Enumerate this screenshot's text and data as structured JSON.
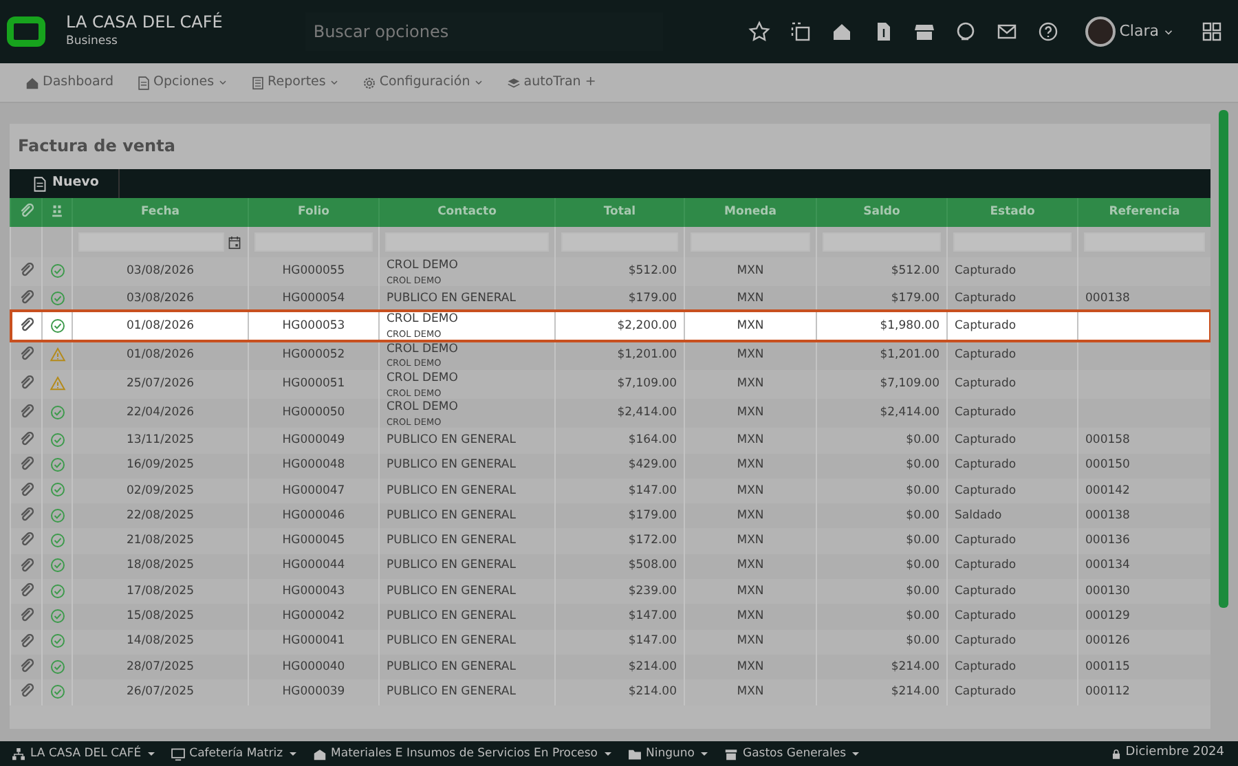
{
  "app": {
    "title": "LA CASA DEL CAFÉ",
    "subtitle": "Business",
    "search": {
      "placeholder": "Buscar opciones"
    },
    "user": "Clara"
  },
  "nav": [
    {
      "label": "Dashboard",
      "dropdown": false
    },
    {
      "label": "Opciones",
      "dropdown": true
    },
    {
      "label": "Reportes",
      "dropdown": true
    },
    {
      "label": "Configuración",
      "dropdown": true
    },
    {
      "label": "autoTran +",
      "dropdown": false
    }
  ],
  "page": {
    "title": "Factura de venta",
    "new_button": "Nuevo"
  },
  "table": {
    "columns": [
      "Fecha",
      "Folio",
      "Contacto",
      "Total",
      "Moneda",
      "Saldo",
      "Estado",
      "Referencia"
    ],
    "rows": [
      {
        "kind": "ok",
        "selected": false,
        "fecha": "03/08/2026",
        "folio": "HG000055",
        "contacto": "CROL DEMO",
        "contacto_sub": "CROL DEMO",
        "total": "$512.00",
        "moneda": "MXN",
        "saldo": "$512.00",
        "estado": "Capturado"
      },
      {
        "kind": "ok",
        "selected": false,
        "fecha": "03/08/2026",
        "folio": "HG000054",
        "contacto": "PUBLICO EN GENERAL",
        "total": "$179.00",
        "moneda": "MXN",
        "saldo": "$179.00",
        "estado": "Capturado",
        "referencia": "000138"
      },
      {
        "kind": "ok",
        "selected": true,
        "fecha": "01/08/2026",
        "folio": "HG000053",
        "contacto": "CROL DEMO",
        "contacto_sub": "CROL DEMO",
        "total": "$2,200.00",
        "moneda": "MXN",
        "saldo": "$1,980.00",
        "estado": "Capturado"
      },
      {
        "kind": "warning",
        "selected": false,
        "fecha": "01/08/2026",
        "folio": "HG000052",
        "contacto": "CROL DEMO",
        "contacto_sub": "CROL DEMO",
        "total": "$1,201.00",
        "moneda": "MXN",
        "saldo": "$1,201.00",
        "estado": "Capturado"
      },
      {
        "kind": "warning",
        "selected": false,
        "fecha": "25/07/2026",
        "folio": "HG000051",
        "contacto": "CROL DEMO",
        "contacto_sub": "CROL DEMO",
        "total": "$7,109.00",
        "moneda": "MXN",
        "saldo": "$7,109.00",
        "estado": "Capturado"
      },
      {
        "kind": "ok",
        "selected": false,
        "fecha": "22/04/2026",
        "folio": "HG000050",
        "contacto": "CROL DEMO",
        "contacto_sub": "CROL DEMO",
        "total": "$2,414.00",
        "moneda": "MXN",
        "saldo": "$2,414.00",
        "estado": "Capturado"
      },
      {
        "kind": "ok",
        "selected": false,
        "fecha": "13/11/2025",
        "folio": "HG000049",
        "contacto": "PUBLICO EN GENERAL",
        "total": "$164.00",
        "moneda": "MXN",
        "saldo": "$0.00",
        "estado": "Capturado",
        "referencia": "000158"
      },
      {
        "kind": "ok",
        "selected": false,
        "fecha": "16/09/2025",
        "folio": "HG000048",
        "contacto": "PUBLICO EN GENERAL",
        "total": "$429.00",
        "moneda": "MXN",
        "saldo": "$0.00",
        "estado": "Capturado",
        "referencia": "000150"
      },
      {
        "kind": "ok",
        "selected": false,
        "fecha": "02/09/2025",
        "folio": "HG000047",
        "contacto": "PUBLICO EN GENERAL",
        "total": "$147.00",
        "moneda": "MXN",
        "saldo": "$0.00",
        "estado": "Capturado",
        "referencia": "000142"
      },
      {
        "kind": "ok",
        "selected": false,
        "fecha": "22/08/2025",
        "folio": "HG000046",
        "contacto": "PUBLICO EN GENERAL",
        "total": "$179.00",
        "moneda": "MXN",
        "saldo": "$0.00",
        "estado": "Saldado",
        "referencia": "000138"
      },
      {
        "kind": "ok",
        "selected": false,
        "fecha": "21/08/2025",
        "folio": "HG000045",
        "contacto": "PUBLICO EN GENERAL",
        "total": "$172.00",
        "moneda": "MXN",
        "saldo": "$0.00",
        "estado": "Capturado",
        "referencia": "000136"
      },
      {
        "kind": "ok",
        "selected": false,
        "fecha": "18/08/2025",
        "folio": "HG000044",
        "contacto": "PUBLICO EN GENERAL",
        "total": "$508.00",
        "moneda": "MXN",
        "saldo": "$0.00",
        "estado": "Capturado",
        "referencia": "000134"
      },
      {
        "kind": "ok",
        "selected": false,
        "fecha": "17/08/2025",
        "folio": "HG000043",
        "contacto": "PUBLICO EN GENERAL",
        "total": "$239.00",
        "moneda": "MXN",
        "saldo": "$0.00",
        "estado": "Capturado",
        "referencia": "000130"
      },
      {
        "kind": "ok",
        "selected": false,
        "fecha": "15/08/2025",
        "folio": "HG000042",
        "contacto": "PUBLICO EN GENERAL",
        "total": "$147.00",
        "moneda": "MXN",
        "saldo": "$0.00",
        "estado": "Capturado",
        "referencia": "000129"
      },
      {
        "kind": "ok",
        "selected": false,
        "fecha": "14/08/2025",
        "folio": "HG000041",
        "contacto": "PUBLICO EN GENERAL",
        "total": "$147.00",
        "moneda": "MXN",
        "saldo": "$0.00",
        "estado": "Capturado",
        "referencia": "000126"
      },
      {
        "kind": "ok",
        "selected": false,
        "fecha": "28/07/2025",
        "folio": "HG000040",
        "contacto": "PUBLICO EN GENERAL",
        "total": "$214.00",
        "moneda": "MXN",
        "saldo": "$214.00",
        "estado": "Capturado",
        "referencia": "000115"
      },
      {
        "kind": "ok",
        "selected": false,
        "fecha": "26/07/2025",
        "folio": "HG000039",
        "contacto": "PUBLICO EN GENERAL",
        "total": "$214.00",
        "moneda": "MXN",
        "saldo": "$214.00",
        "estado": "Capturado",
        "referencia": "000112"
      }
    ]
  },
  "status_bar": {
    "items": [
      "LA CASA DEL CAFÉ",
      "Cafetería Matriz",
      "Materiales E Insumos de Servicios En Proceso",
      "Ninguno",
      "Gastos Generales"
    ],
    "period": "Diciembre 2024"
  }
}
